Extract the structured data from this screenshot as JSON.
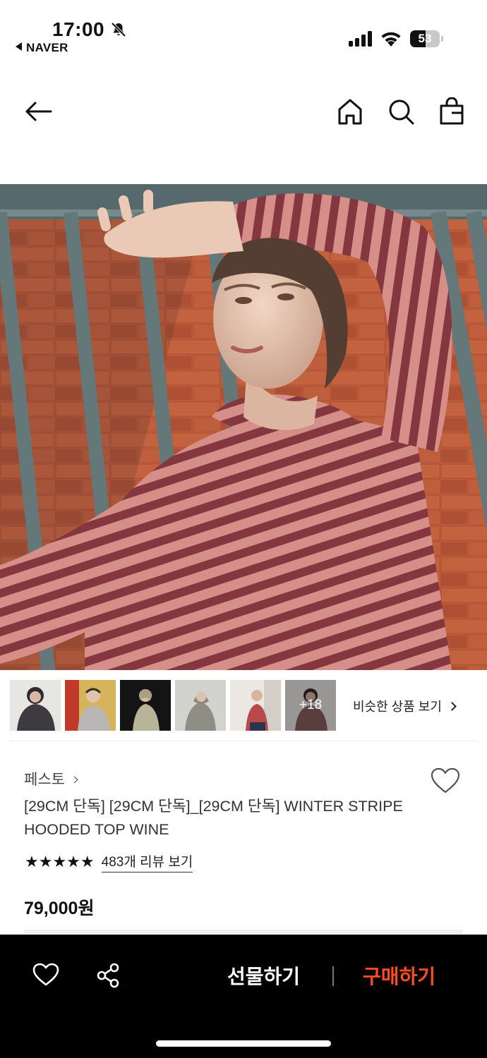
{
  "status_bar": {
    "time": "17:00",
    "back_app": "NAVER",
    "battery": "53",
    "battery_level": 0.53,
    "icons": [
      "bell-off-icon",
      "signal-icon",
      "wifi-icon",
      "battery-icon"
    ]
  },
  "nav": {
    "icons": [
      "back-arrow-icon",
      "home-icon",
      "search-icon",
      "shopping-bag-icon"
    ]
  },
  "gallery": {
    "more_count": "+18",
    "similar_label": "비슷한 상품 보기"
  },
  "product": {
    "brand": "페스토",
    "title": "[29CM 단독] [29CM 단독]_[29CM 단독] WINTER STRIPE HOODED TOP WINE",
    "rating_stars": "★★★★★",
    "rating": 5,
    "review_link": "483개 리뷰 보기",
    "price": "79,000원"
  },
  "bottom_bar": {
    "gift_label": "선물하기",
    "buy_label": "구매하기"
  },
  "colors": {
    "buy_accent": "#ff4b1f",
    "bar_background": "#000000",
    "stripe_wine": "#7a2a33",
    "stripe_pink": "#d98a86",
    "brick": "#b04a2a"
  }
}
